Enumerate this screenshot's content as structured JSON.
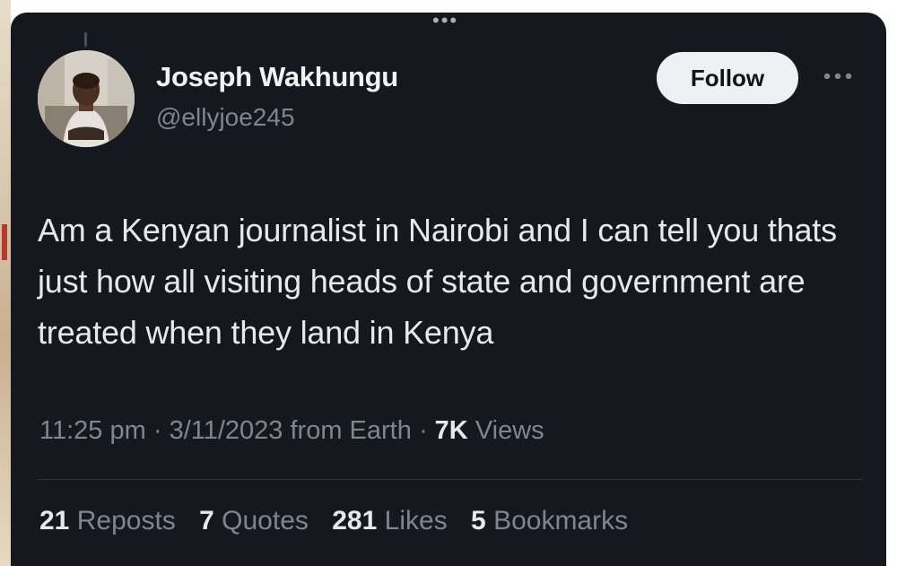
{
  "tweet": {
    "author_name": "Joseph Wakhungu",
    "author_handle": "@ellyjoe245",
    "follow_label": "Follow",
    "text": "Am a Kenyan journalist in Nairobi and I can tell you thats just how all visiting heads of state and government are treated when they land in Kenya",
    "time": "11:25 pm",
    "date": "3/11/2023",
    "source": "from Earth",
    "separator": "·",
    "views_count": "7K",
    "views_label": "Views"
  },
  "stats": [
    {
      "count": "21",
      "label": "Reposts"
    },
    {
      "count": "7",
      "label": "Quotes"
    },
    {
      "count": "281",
      "label": "Likes"
    },
    {
      "count": "5",
      "label": "Bookmarks"
    }
  ],
  "icons": {
    "more": "more-horizontal-icon",
    "grabber": "drag-handle-icon",
    "avatar": "profile-photo"
  },
  "colors": {
    "background": "#15181f",
    "primary_text": "#e7e9ea",
    "secondary_text": "#7d8791",
    "follow_button": "#eef0f2"
  }
}
